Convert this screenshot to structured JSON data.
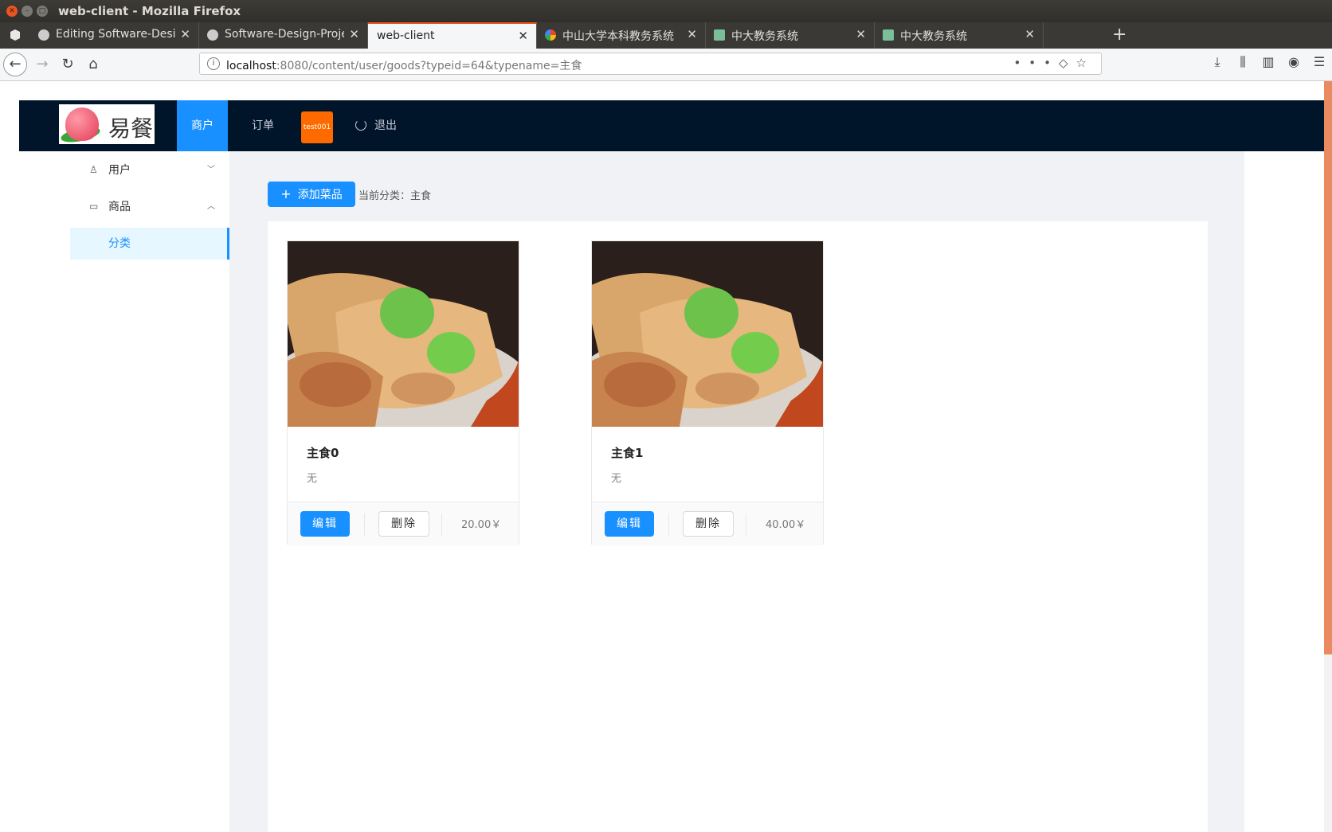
{
  "window": {
    "title": "web-client - Mozilla Firefox"
  },
  "tabs": [
    {
      "label": "Editing Software-Desigr",
      "icon": "github-icon"
    },
    {
      "label": "Software-Design-Projec",
      "icon": "github-icon"
    },
    {
      "label": "web-client",
      "icon": "none",
      "active": true
    },
    {
      "label": "中山大学本科教务系统 - (",
      "icon": "google-icon"
    },
    {
      "label": "中大教务系统",
      "icon": "sysu-icon"
    },
    {
      "label": "中大教务系统",
      "icon": "sysu-icon"
    }
  ],
  "url": {
    "host": "localhost",
    "rest": ":8080/content/user/goods?typeid=64&typename=主食"
  },
  "app": {
    "logo_text": "易餐",
    "nav": {
      "merchant": "商户",
      "orders": "订单",
      "user": "test001",
      "logout": "退出"
    },
    "sidebar": {
      "users": "用户",
      "goods": "商品",
      "category": "分类"
    },
    "toolbar": {
      "add_label": "添加菜品",
      "current_type": "当前分类：主食"
    }
  },
  "goods": [
    {
      "name": "主食0",
      "desc": "无",
      "price": "20.00￥",
      "edit": "编辑",
      "delete": "删除"
    },
    {
      "name": "主食1",
      "desc": "无",
      "price": "40.00￥",
      "edit": "编辑",
      "delete": "删除"
    }
  ],
  "colors": {
    "primary": "#1890ff",
    "header": "#001529",
    "avatar": "#ff6a00",
    "content_bg": "#f0f2f5"
  }
}
